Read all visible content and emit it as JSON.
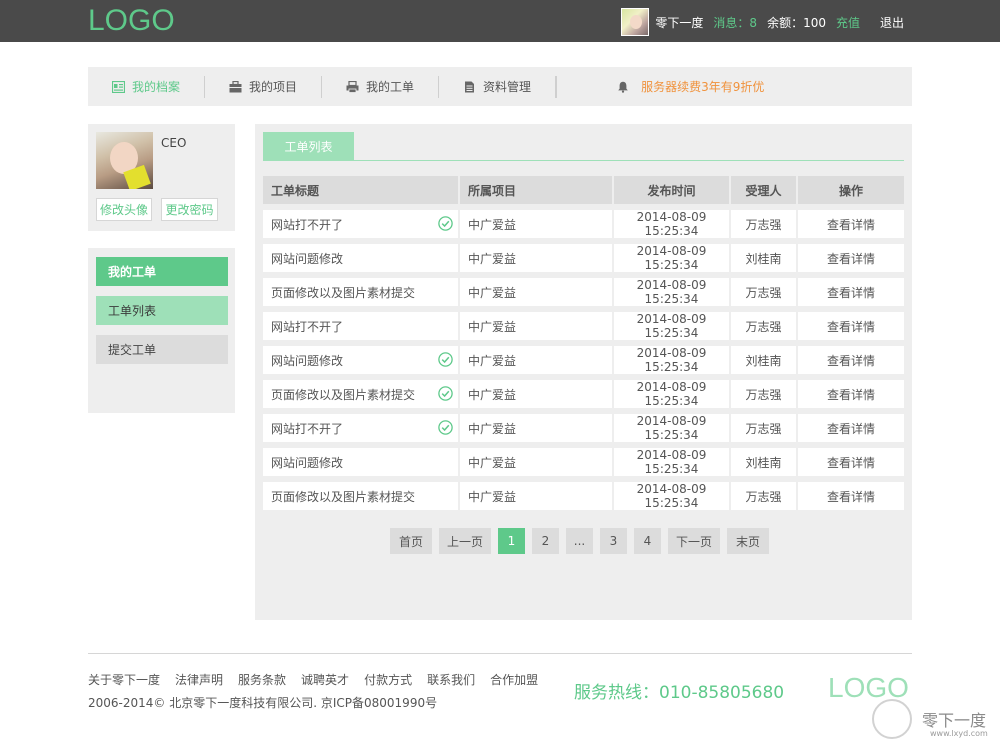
{
  "header": {
    "logo": "LOGO",
    "user_name": "零下一度",
    "messages": "消息：8",
    "balance": "余额：100",
    "recharge": "充值",
    "logout": "退出"
  },
  "nav": {
    "items": [
      {
        "label": "我的档案",
        "icon": "profile-card-icon"
      },
      {
        "label": "我的项目",
        "icon": "briefcase-icon"
      },
      {
        "label": "我的工单",
        "icon": "printer-icon"
      },
      {
        "label": "资料管理",
        "icon": "document-icon"
      }
    ],
    "notice": "服务器续费3年有9折优",
    "notice_icon": "bell-icon"
  },
  "profile": {
    "role": "CEO",
    "change_avatar": "修改头像",
    "change_password": "更改密码"
  },
  "side_menu": {
    "header": "我的工单",
    "items": [
      "工单列表",
      "提交工单"
    ]
  },
  "main": {
    "tab": "工单列表",
    "columns": [
      "工单标题",
      "所属项目",
      "发布时间",
      "受理人",
      "操作"
    ],
    "rows": [
      {
        "title": "网站打不开了",
        "project": "中广爱益",
        "time": "2014-08-09 15:25:34",
        "owner": "万志强",
        "action": "查看详情",
        "done": true
      },
      {
        "title": "网站问题修改",
        "project": "中广爱益",
        "time": "2014-08-09 15:25:34",
        "owner": "刘桂南",
        "action": "查看详情",
        "done": false
      },
      {
        "title": "页面修改以及图片素材提交",
        "project": "中广爱益",
        "time": "2014-08-09 15:25:34",
        "owner": "万志强",
        "action": "查看详情",
        "done": false
      },
      {
        "title": "网站打不开了",
        "project": "中广爱益",
        "time": "2014-08-09 15:25:34",
        "owner": "万志强",
        "action": "查看详情",
        "done": false
      },
      {
        "title": "网站问题修改",
        "project": "中广爱益",
        "time": "2014-08-09 15:25:34",
        "owner": "刘桂南",
        "action": "查看详情",
        "done": true
      },
      {
        "title": "页面修改以及图片素材提交",
        "project": "中广爱益",
        "time": "2014-08-09 15:25:34",
        "owner": "万志强",
        "action": "查看详情",
        "done": true
      },
      {
        "title": "网站打不开了",
        "project": "中广爱益",
        "time": "2014-08-09 15:25:34",
        "owner": "万志强",
        "action": "查看详情",
        "done": true
      },
      {
        "title": "网站问题修改",
        "project": "中广爱益",
        "time": "2014-08-09 15:25:34",
        "owner": "刘桂南",
        "action": "查看详情",
        "done": false
      },
      {
        "title": "页面修改以及图片素材提交",
        "project": "中广爱益",
        "time": "2014-08-09 15:25:34",
        "owner": "万志强",
        "action": "查看详情",
        "done": false
      }
    ],
    "pager": {
      "first": "首页",
      "prev": "上一页",
      "pages": [
        "1",
        "2",
        "...",
        "3",
        "4"
      ],
      "current": "1",
      "next": "下一页",
      "last": "末页"
    }
  },
  "footer": {
    "links": [
      "关于零下一度",
      "法律声明",
      "服务条款",
      "诚聘英才",
      "付款方式",
      "联系我们",
      "合作加盟"
    ],
    "copyright": "2006-2014© 北京零下一度科技有限公司.  京ICP备08001990号",
    "hotline": "服务热线：010-85805680",
    "logo": "LOGO"
  },
  "watermark": {
    "text": "零下一度",
    "url": "www.lxyd.com"
  },
  "colors": {
    "accent": "#5ec98a",
    "accent_light": "#9ee0b8",
    "header_bg": "#4a4a4a",
    "notice": "#f0923c"
  }
}
